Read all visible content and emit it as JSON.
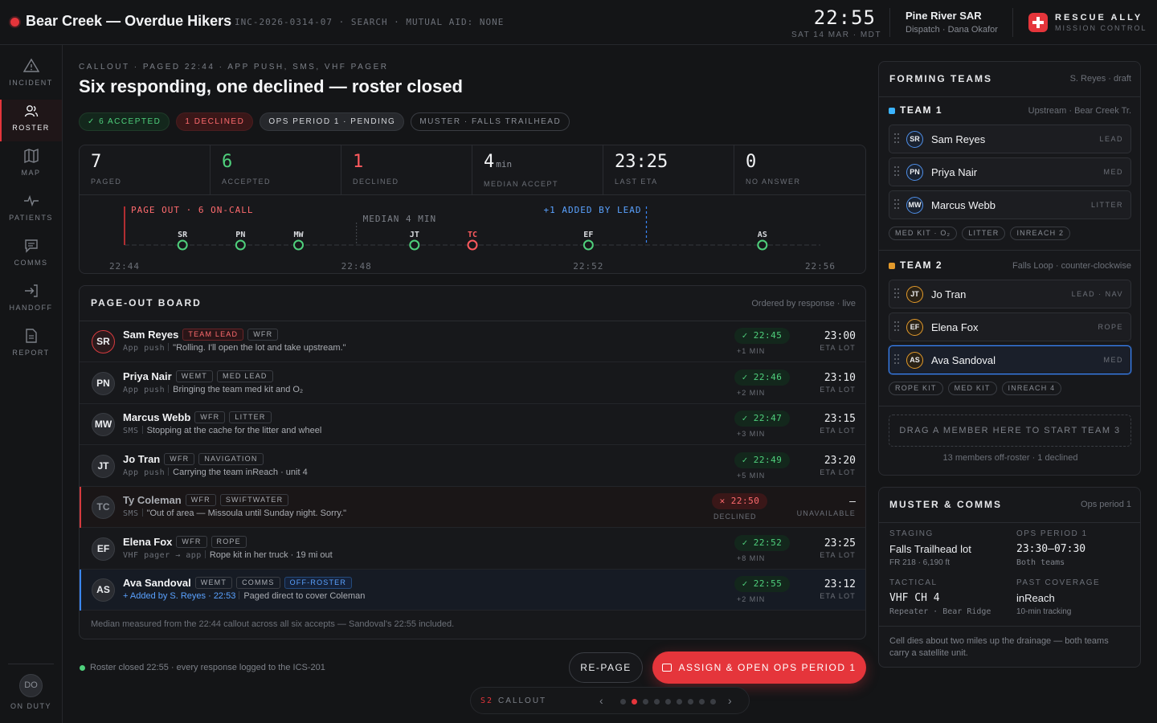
{
  "topbar": {
    "incident_title": "Bear Creek — Overdue Hikers",
    "meta": "INC-2026-0314-07 · SEARCH · MUTUAL AID: NONE",
    "time": "22:55",
    "date": "SAT 14 MAR · MDT",
    "org_name": "Pine River SAR",
    "org_sub": "Dispatch · Dana Okafor",
    "brand_1": "RESCUE ALLY",
    "brand_2": "MISSION CONTROL",
    "accent_color": "#e5353b"
  },
  "sidebar": {
    "items": [
      {
        "label": "INCIDENT",
        "icon": "warning-icon"
      },
      {
        "label": "ROSTER",
        "icon": "users-icon",
        "active": true
      },
      {
        "label": "MAP",
        "icon": "map-icon"
      },
      {
        "label": "PATIENTS",
        "icon": "pulse-icon"
      },
      {
        "label": "COMMS",
        "icon": "chat-icon"
      },
      {
        "label": "HANDOFF",
        "icon": "handoff-icon"
      },
      {
        "label": "REPORT",
        "icon": "document-icon"
      }
    ],
    "user_initials": "DO",
    "user_status": "ON DUTY"
  },
  "header": {
    "eyebrow": "CALLOUT · PAGED 22:44 · APP PUSH, SMS, VHF PAGER",
    "headline": "Six responding, one declined — roster closed",
    "pills": {
      "accepted": "✓ 6 ACCEPTED",
      "declined": "1 DECLINED",
      "ops": "OPS PERIOD 1 · PENDING",
      "muster": "MUSTER · FALLS TRAILHEAD"
    }
  },
  "stats": [
    {
      "value": "7",
      "unit": "",
      "label": "PAGED"
    },
    {
      "value": "6",
      "unit": "",
      "label": "ACCEPTED"
    },
    {
      "value": "1",
      "unit": "",
      "label": "DECLINED"
    },
    {
      "value": "4",
      "unit": "min",
      "label": "MEDIAN ACCEPT"
    },
    {
      "value": "23:25",
      "unit": "",
      "label": "LAST ETA"
    },
    {
      "value": "0",
      "unit": "",
      "label": "NO ANSWER"
    }
  ],
  "timeline": {
    "page_out_label": "PAGE OUT · 6 ON-CALL",
    "median_label": "MEDIAN 4 MIN",
    "added_label": "+1 ADDED BY LEAD",
    "ticks": [
      "22:44",
      "22:48",
      "22:52",
      "22:56"
    ],
    "range_minutes": [
      0,
      12
    ],
    "median_minute": 4,
    "added_minute": 9,
    "responses": [
      {
        "initials": "SR",
        "minute": 1,
        "status": "accepted"
      },
      {
        "initials": "PN",
        "minute": 2,
        "status": "accepted"
      },
      {
        "initials": "MW",
        "minute": 3,
        "status": "accepted"
      },
      {
        "initials": "JT",
        "minute": 5,
        "status": "accepted"
      },
      {
        "initials": "TC",
        "minute": 6,
        "status": "declined"
      },
      {
        "initials": "EF",
        "minute": 8,
        "status": "accepted"
      },
      {
        "initials": "AS",
        "minute": 11,
        "status": "accepted"
      }
    ],
    "accept_color": "#4fd07c",
    "decline_color": "#ff5a5e"
  },
  "board": {
    "title": "PAGE-OUT BOARD",
    "subtitle": "Ordered by response · live",
    "footer": "Median measured from the 22:44 callout across all six accepts — Sandoval's 22:55 included.",
    "rows": [
      {
        "initials": "SR",
        "name": "Sam Reyes",
        "tags": [
          "TEAM LEAD",
          "WFR"
        ],
        "channel": "App push",
        "message": "\"Rolling. I'll open the lot and take upstream.\"",
        "response": "✓ 22:45",
        "delta": "+1 MIN",
        "eta": "23:00",
        "eta_label": "ETA LOT"
      },
      {
        "initials": "PN",
        "name": "Priya Nair",
        "tags": [
          "WEMT",
          "MED LEAD"
        ],
        "channel": "App push",
        "message": "Bringing the team med kit and O₂",
        "response": "✓ 22:46",
        "delta": "+2 MIN",
        "eta": "23:10",
        "eta_label": "ETA LOT"
      },
      {
        "initials": "MW",
        "name": "Marcus Webb",
        "tags": [
          "WFR",
          "LITTER"
        ],
        "channel": "SMS",
        "message": "Stopping at the cache for the litter and wheel",
        "response": "✓ 22:47",
        "delta": "+3 MIN",
        "eta": "23:15",
        "eta_label": "ETA LOT"
      },
      {
        "initials": "JT",
        "name": "Jo Tran",
        "tags": [
          "WFR",
          "NAVIGATION"
        ],
        "channel": "App push",
        "message": "Carrying the team inReach · unit 4",
        "response": "✓ 22:49",
        "delta": "+5 MIN",
        "eta": "23:20",
        "eta_label": "ETA LOT"
      },
      {
        "initials": "TC",
        "name": "Ty Coleman",
        "tags": [
          "WFR",
          "SWIFTWATER"
        ],
        "channel": "SMS",
        "message": "\"Out of area — Missoula until Sunday night. Sorry.\"",
        "response": "✕ 22:50",
        "delta": "DECLINED",
        "eta": "—",
        "eta_label": "UNAVAILABLE"
      },
      {
        "initials": "EF",
        "name": "Elena Fox",
        "tags": [
          "WFR",
          "ROPE"
        ],
        "channel": "VHF pager → app",
        "message": "Rope kit in her truck · 19 mi out",
        "response": "✓ 22:52",
        "delta": "+8 MIN",
        "eta": "23:25",
        "eta_label": "ETA LOT"
      },
      {
        "initials": "AS",
        "name": "Ava Sandoval",
        "tags": [
          "WEMT",
          "COMMS",
          "OFF-ROSTER"
        ],
        "added_by": "+ Added by S. Reyes · 22:53",
        "message": "Paged direct to cover Coleman",
        "response": "✓ 22:55",
        "delta": "+2 MIN",
        "eta": "23:12",
        "eta_label": "ETA LOT"
      }
    ]
  },
  "actions": {
    "status": "Roster closed 22:55 · every response logged to the ICS-201",
    "repage": "RE-PAGE",
    "assign": "ASSIGN & OPEN OPS PERIOD 1"
  },
  "pager": {
    "scene_num": "S2",
    "scene_label": "CALLOUT",
    "prev": "‹",
    "next": "›",
    "total": 9,
    "current": 2
  },
  "forming": {
    "title": "FORMING TEAMS",
    "subtitle": "S. Reyes · draft",
    "teams": [
      {
        "name": "TEAM 1",
        "route": "Upstream · Bear Creek Tr.",
        "color": "#3bb4ff",
        "members": [
          {
            "initials": "SR",
            "name": "Sam Reyes",
            "role": "LEAD"
          },
          {
            "initials": "PN",
            "name": "Priya Nair",
            "role": "MED"
          },
          {
            "initials": "MW",
            "name": "Marcus Webb",
            "role": "LITTER"
          }
        ],
        "kit": [
          "MED KIT · O₂",
          "LITTER",
          "INREACH 2"
        ]
      },
      {
        "name": "TEAM 2",
        "route": "Falls Loop · counter-clockwise",
        "color": "#e39a2b",
        "members": [
          {
            "initials": "JT",
            "name": "Jo Tran",
            "role": "LEAD · NAV"
          },
          {
            "initials": "EF",
            "name": "Elena Fox",
            "role": "ROPE"
          },
          {
            "initials": "AS",
            "name": "Ava Sandoval",
            "role": "MED"
          }
        ],
        "kit": [
          "ROPE KIT",
          "MED KIT",
          "INREACH 4"
        ]
      }
    ],
    "dropzone": "DRAG A MEMBER HERE TO START TEAM 3",
    "footer": "13 members off-roster · 1 declined"
  },
  "muster": {
    "title": "MUSTER & COMMS",
    "subtitle": "Ops period 1",
    "staging_k": "STAGING",
    "staging_v": "Falls Trailhead lot",
    "staging_s": "FR 218 · 6,190 ft",
    "ops_k": "OPS PERIOD 1",
    "ops_v": "23:30–07:30",
    "ops_s": "Both teams",
    "tactical_k": "TACTICAL",
    "tactical_v": "VHF CH 4",
    "tactical_s": "Repeater · Bear Ridge",
    "coverage_k": "PAST COVERAGE",
    "coverage_v": "inReach",
    "coverage_s": "10-min tracking",
    "note": "Cell dies about two miles up the drainage — both teams carry a satellite unit."
  }
}
